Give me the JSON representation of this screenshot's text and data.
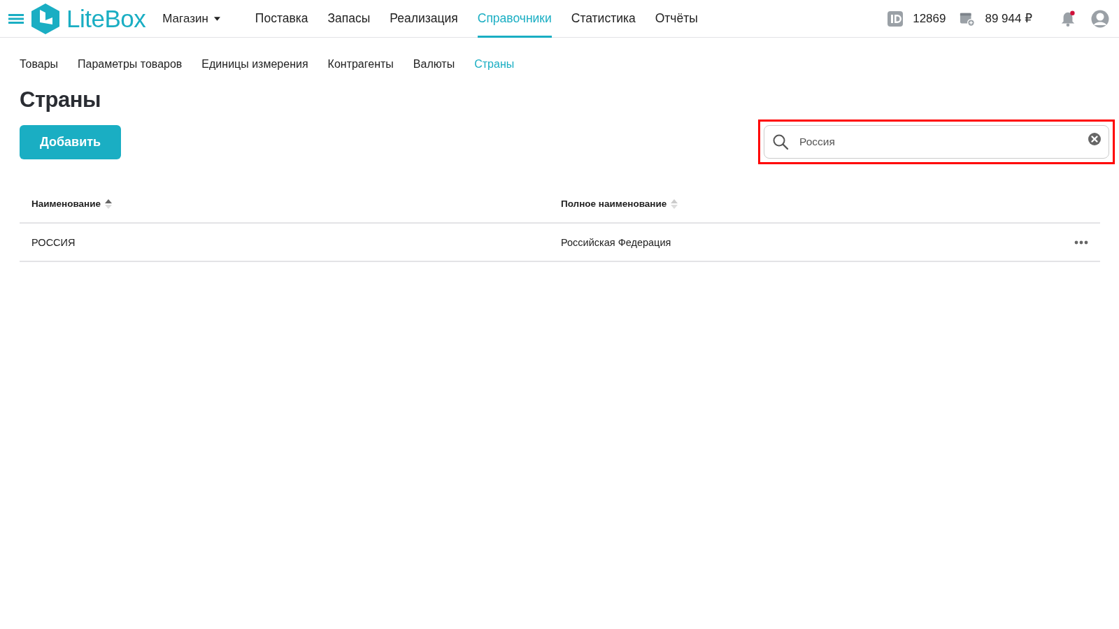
{
  "header": {
    "logo_text": "LiteBox",
    "store": "Магазин",
    "nav": [
      {
        "label": "Поставка",
        "selected": false
      },
      {
        "label": "Запасы",
        "selected": false
      },
      {
        "label": "Реализация",
        "selected": false
      },
      {
        "label": "Справочники",
        "selected": true
      },
      {
        "label": "Статистика",
        "selected": false
      },
      {
        "label": "Отчёты",
        "selected": false
      }
    ],
    "account_id": "12869",
    "balance": "89 944 ₽",
    "notifications_unread": true
  },
  "subnav": [
    {
      "label": "Товары",
      "selected": false
    },
    {
      "label": "Параметры товаров",
      "selected": false
    },
    {
      "label": "Единицы измерения",
      "selected": false
    },
    {
      "label": "Контрагенты",
      "selected": false
    },
    {
      "label": "Валюты",
      "selected": false
    },
    {
      "label": "Страны",
      "selected": true
    }
  ],
  "page_title": "Страны",
  "add_button": "Добавить",
  "search": {
    "value": "Россия",
    "highlighted": true
  },
  "table": {
    "columns": [
      {
        "label": "Наименование",
        "sorted": true
      },
      {
        "label": "Полное наименование",
        "sorted": false
      }
    ],
    "rows": [
      {
        "name": "РОССИЯ",
        "full_name": "Российская Федерация"
      }
    ]
  }
}
